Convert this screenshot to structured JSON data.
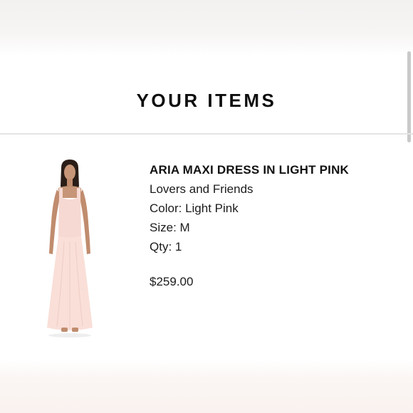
{
  "section": {
    "title": "YOUR ITEMS"
  },
  "item": {
    "name": "ARIA MAXI DRESS IN LIGHT PINK",
    "brand": "Lovers and Friends",
    "color": "Color: Light Pink",
    "size": "Size: M",
    "qty": "Qty: 1",
    "price": "$259.00",
    "image_icon": "dress-model-photo",
    "dress_color": "#f6d9d2"
  }
}
